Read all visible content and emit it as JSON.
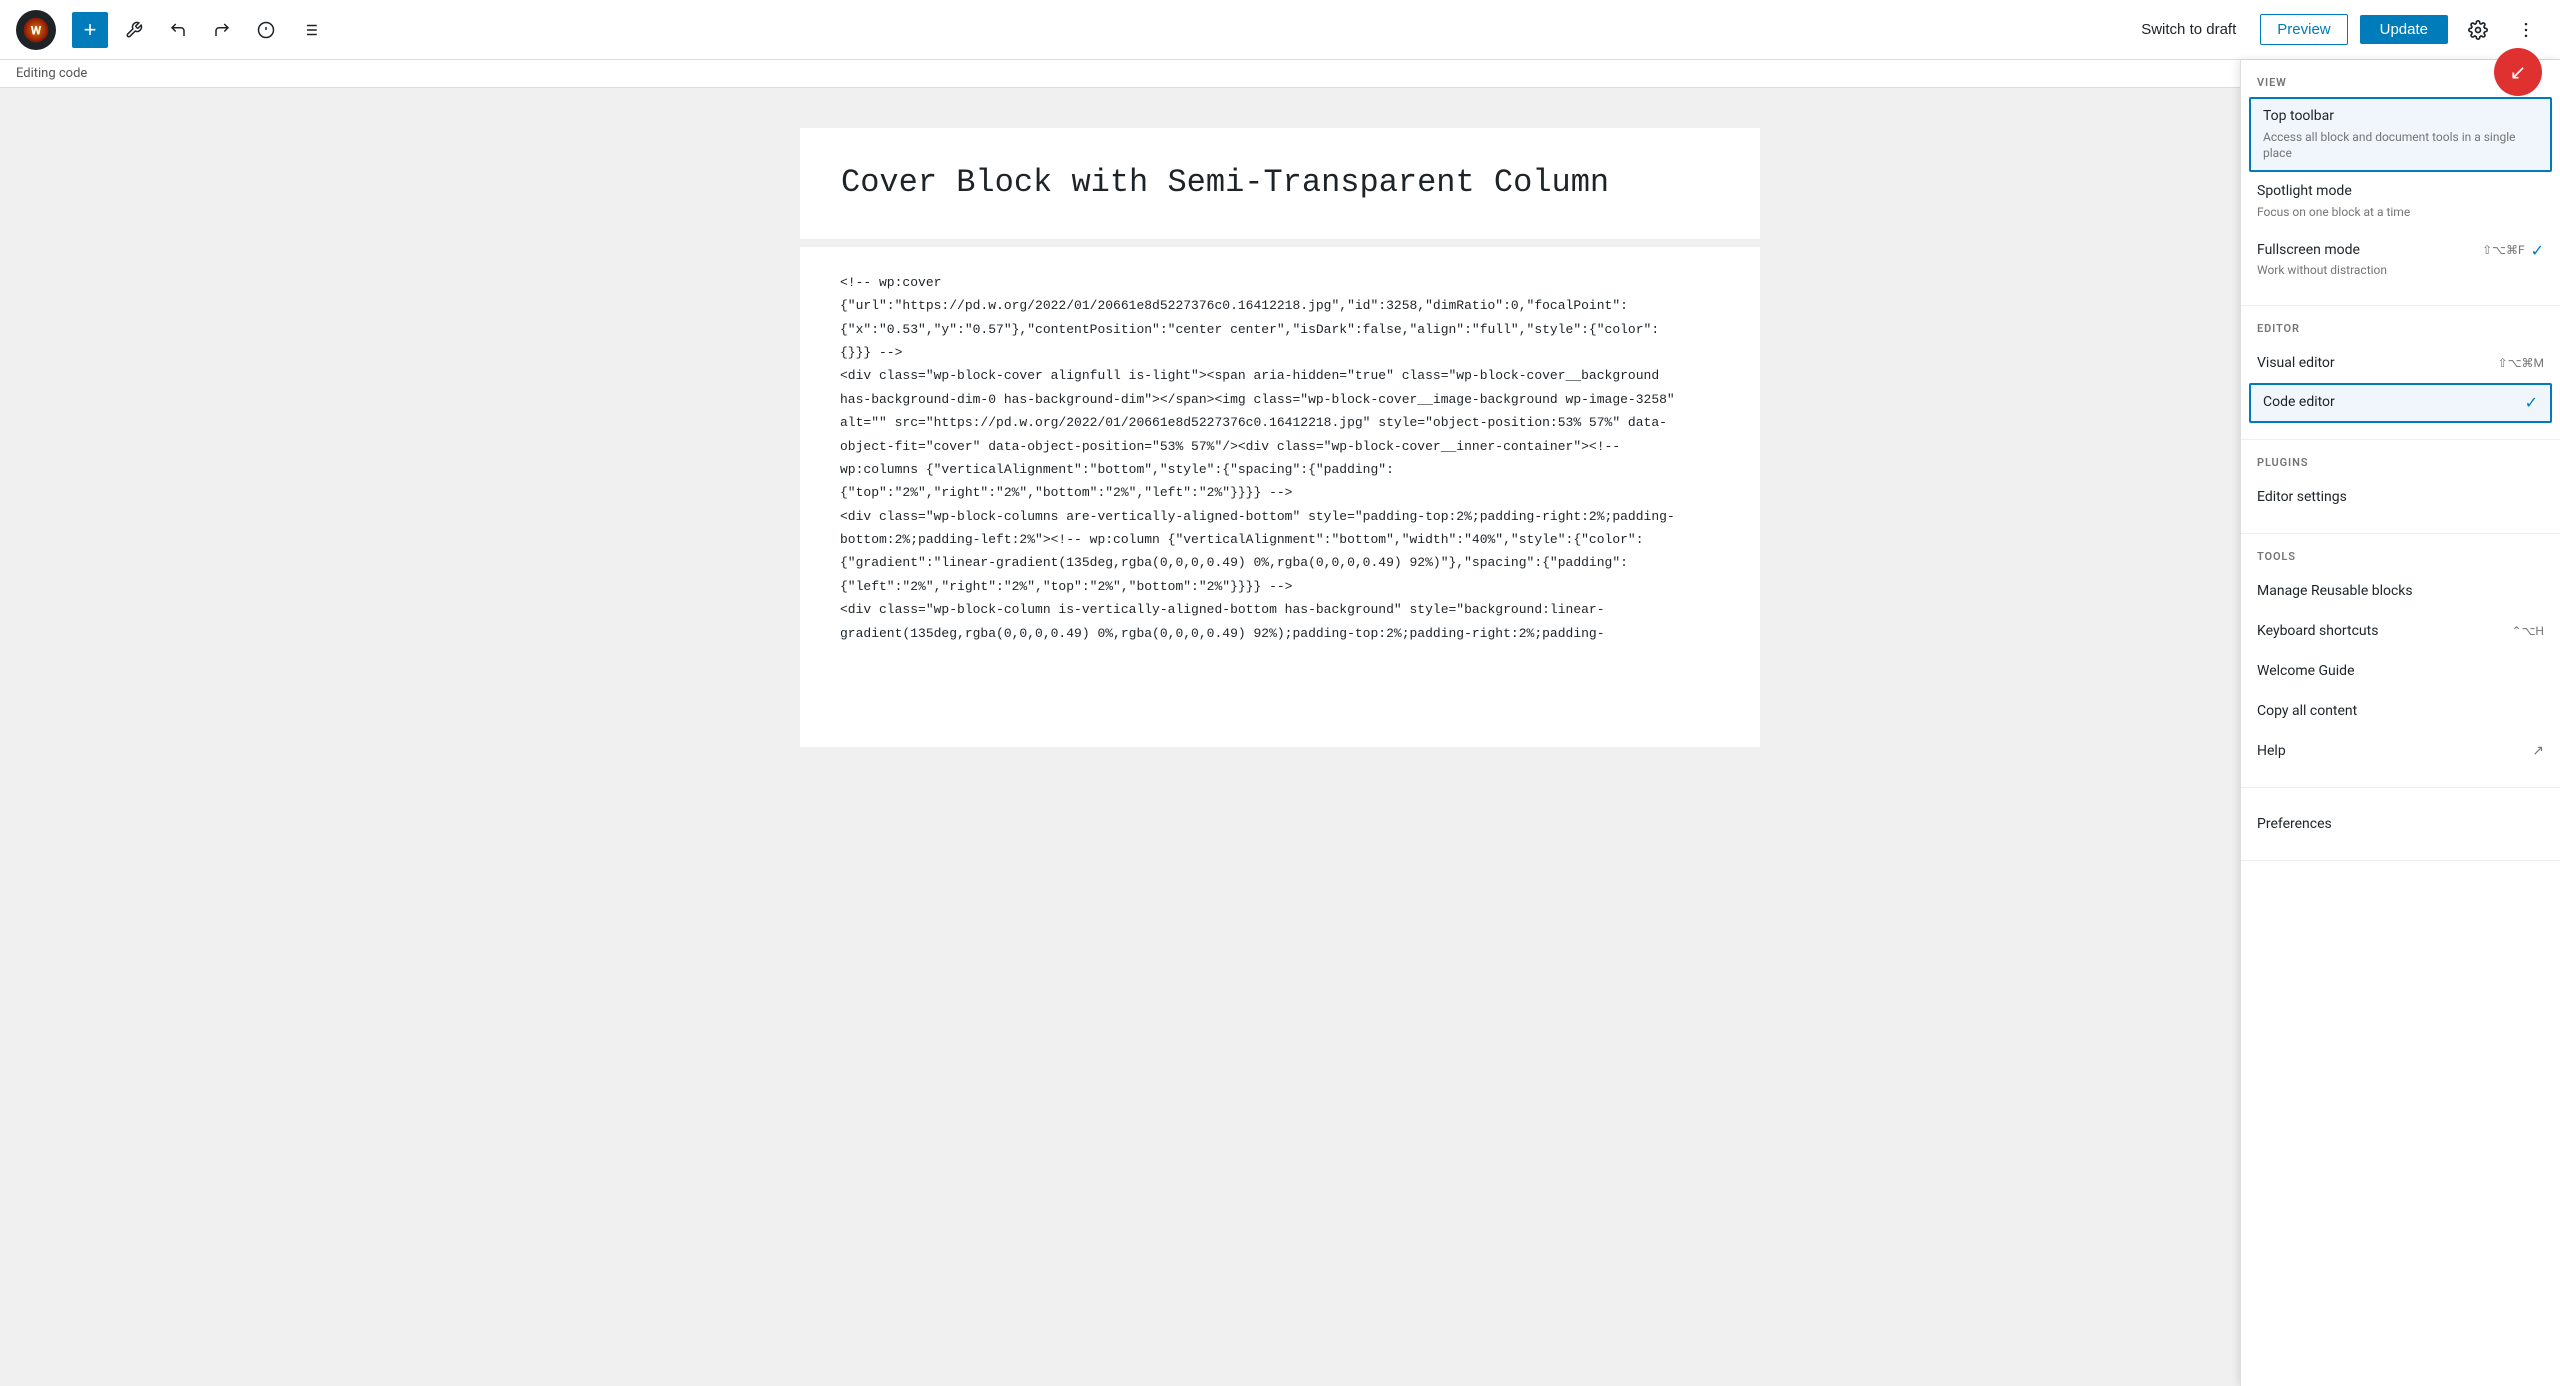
{
  "topbar": {
    "add_label": "+",
    "switch_to_draft_label": "Switch to draft",
    "preview_label": "Preview",
    "update_label": "Update"
  },
  "editing_bar": {
    "label": "Editing code"
  },
  "post": {
    "title": "Cover Block with Semi-Transparent Column",
    "code": "<!-- wp:cover\n{\"url\":\"https://pd.w.org/2022/01/20661e8d5227376c0.16412218.jpg\",\"id\":3258,\"dimRatio\":0,\"focalPoint\":\n{\"x\":\"0.53\",\"y\":\"0.57\"},\"contentPosition\":\"center center\",\"isDark\":false,\"align\":\"full\",\"style\":{\"color\":\n{}}} -->\n<div class=\"wp-block-cover alignfull is-light\"><span aria-hidden=\"true\" class=\"wp-block-cover__background\nhas-background-dim-0 has-background-dim\"></span><img class=\"wp-block-cover__image-background wp-image-3258\"\nalt=\"\" src=\"https://pd.w.org/2022/01/20661e8d5227376c0.16412218.jpg\" style=\"object-position:53% 57%\" data-\nobject-fit=\"cover\" data-object-position=\"53% 57%\"/><div class=\"wp-block-cover__inner-container\"><!--\nwp:columns {\"verticalAlignment\":\"bottom\",\"style\":{\"spacing\":{\"padding\":\n{\"top\":\"2%\",\"right\":\"2%\",\"bottom\":\"2%\",\"left\":\"2%\"}}}} -->\n<div class=\"wp-block-columns are-vertically-aligned-bottom\" style=\"padding-top:2%;padding-right:2%;padding-\nbottom:2%;padding-left:2%\"><!-- wp:column {\"verticalAlignment\":\"bottom\",\"width\":\"40%\",\"style\":{\"color\":\n{\"gradient\":\"linear-gradient(135deg,rgba(0,0,0,0.49) 0%,rgba(0,0,0,0.49) 92%)\"},\"spacing\":{\"padding\":\n{\"left\":\"2%\",\"right\":\"2%\",\"top\":\"2%\",\"bottom\":\"2%\"}}}} -->\n<div class=\"wp-block-column is-vertically-aligned-bottom has-background\" style=\"background:linear-\ngradient(135deg,rgba(0,0,0,0.49) 0%,rgba(0,0,0,0.49) 92%);padding-top:2%;padding-right:2%;padding-"
  },
  "dropdown": {
    "view_section_label": "VIEW",
    "editor_section_label": "EDITOR",
    "plugins_section_label": "PLUGINS",
    "tools_section_label": "TOOLS",
    "items": {
      "top_toolbar": {
        "title": "Top toolbar",
        "desc": "Access all block and document tools in a single place"
      },
      "spotlight_mode": {
        "title": "Spotlight mode",
        "desc": "Focus on one block at a time"
      },
      "fullscreen_mode": {
        "title": "Fullscreen mode",
        "desc": "Work without distraction",
        "shortcut": "⇧⌥⌘F"
      },
      "visual_editor": {
        "title": "Visual editor",
        "shortcut": "⇧⌥⌘M"
      },
      "code_editor": {
        "title": "Code editor"
      },
      "editor_settings": {
        "title": "Editor settings"
      },
      "manage_reusable": {
        "title": "Manage Reusable blocks"
      },
      "keyboard_shortcuts": {
        "title": "Keyboard shortcuts",
        "shortcut": "⌃⌥H"
      },
      "welcome_guide": {
        "title": "Welcome Guide"
      },
      "copy_all": {
        "title": "Copy all content"
      },
      "help": {
        "title": "Help"
      },
      "preferences": {
        "title": "Preferences"
      }
    }
  }
}
